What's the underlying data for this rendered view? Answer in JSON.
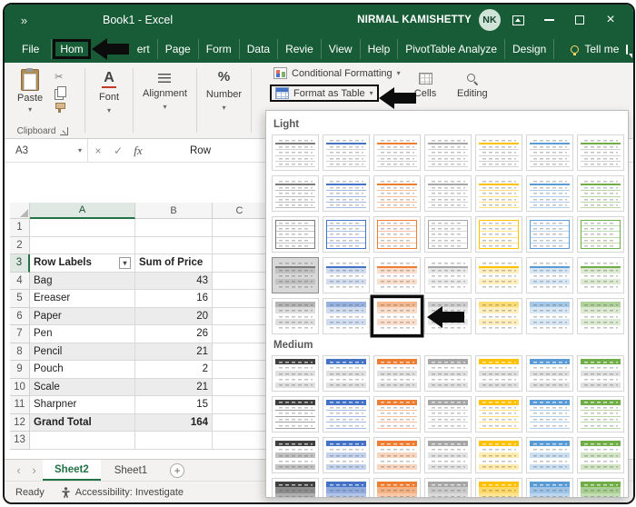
{
  "window": {
    "title": "Book1 - Excel",
    "user_name": "NIRMAL KAMISHETTY",
    "user_initials": "NK",
    "quick_access": "»"
  },
  "ribbon": {
    "tabs": [
      "File",
      "Hom",
      "ert",
      "Page",
      "Form",
      "Data",
      "Revie",
      "View",
      "Help",
      "PivotTable Analyze",
      "Design"
    ],
    "boxed_tab": "Hom",
    "tell_me": "Tell me",
    "clipboard": {
      "paste": "Paste",
      "group": "Clipboard"
    },
    "font_group": "Font",
    "alignment_group": "Alignment",
    "number_group": "Number",
    "styles": {
      "conditional_formatting": "Conditional Formatting",
      "format_as_table": "Format as Table"
    },
    "cells_group": "Cells",
    "editing_group": "Editing"
  },
  "formula_bar": {
    "name_box": "A3",
    "cancel": "×",
    "enter": "✓",
    "fx": "fx",
    "content": "Row"
  },
  "grid": {
    "columns": [
      "A",
      "B",
      "C"
    ],
    "selected_cell": "A3",
    "rows": [
      {
        "n": "1",
        "a": "",
        "b": ""
      },
      {
        "n": "2",
        "a": "",
        "b": ""
      },
      {
        "n": "3",
        "a": "Row Labels",
        "b": "Sum of Price",
        "kind": "header"
      },
      {
        "n": "4",
        "a": "Bag",
        "b": "43"
      },
      {
        "n": "5",
        "a": "Ereaser",
        "b": "16"
      },
      {
        "n": "6",
        "a": "Paper",
        "b": "20"
      },
      {
        "n": "7",
        "a": "Pen",
        "b": "26"
      },
      {
        "n": "8",
        "a": "Pencil",
        "b": "21"
      },
      {
        "n": "9",
        "a": "Pouch",
        "b": "2"
      },
      {
        "n": "10",
        "a": "Scale",
        "b": "21"
      },
      {
        "n": "11",
        "a": "Sharpner",
        "b": "15"
      },
      {
        "n": "12",
        "a": "Grand Total",
        "b": "164",
        "kind": "total"
      },
      {
        "n": "13",
        "a": "",
        "b": ""
      }
    ]
  },
  "sheet_bar": {
    "tabs": [
      {
        "label": "Sheet2",
        "active": true
      },
      {
        "label": "Sheet1",
        "active": false
      }
    ]
  },
  "status_bar": {
    "mode": "Ready",
    "accessibility": "Accessibility: Investigate"
  },
  "style_gallery": {
    "light_label": "Light",
    "medium_label": "Medium",
    "palette": {
      "dark": "#7a7a7a",
      "black": "#404040",
      "blue": "#4472c4",
      "orange": "#ed7d31",
      "gray": "#a6a6a6",
      "yellow": "#ffc000",
      "blue2": "#5b9bd5",
      "green": "#70ad47"
    },
    "light_rows": [
      {
        "variant": "lines",
        "cols": [
          "dark",
          "blue",
          "orange",
          "gray",
          "yellow",
          "blue2",
          "green"
        ]
      },
      {
        "variant": "lines2",
        "cols": [
          "dark",
          "blue",
          "orange",
          "gray",
          "yellow",
          "blue2",
          "green"
        ]
      },
      {
        "variant": "boxed",
        "cols": [
          "dark",
          "blue",
          "orange",
          "gray",
          "yellow",
          "blue2",
          "green"
        ]
      },
      {
        "variant": "banded",
        "cols": [
          "dark",
          "blue",
          "orange",
          "gray",
          "yellow",
          "blue2",
          "green"
        ],
        "selected_col": 1
      },
      {
        "variant": "banded2",
        "cols": [
          "dark",
          "blue",
          "orange",
          "gray",
          "yellow",
          "blue2",
          "green"
        ],
        "annotated_col": 3
      }
    ],
    "medium_rows": [
      {
        "variant": "mheader",
        "cols": [
          "black",
          "blue",
          "orange",
          "gray",
          "yellow",
          "blue2",
          "green"
        ]
      },
      {
        "variant": "mlines",
        "cols": [
          "black",
          "blue",
          "orange",
          "gray",
          "yellow",
          "blue2",
          "green"
        ]
      },
      {
        "variant": "mbanded",
        "cols": [
          "black",
          "blue",
          "orange",
          "gray",
          "yellow",
          "blue2",
          "green"
        ]
      },
      {
        "variant": "msolid",
        "cols": [
          "black",
          "blue",
          "orange",
          "gray",
          "yellow",
          "blue2",
          "green"
        ]
      }
    ]
  },
  "colors": {
    "title_green": "#185c37",
    "accent_green": "#217346",
    "band_gray": "#ececec",
    "annotation_black": "#0c0c0c"
  }
}
